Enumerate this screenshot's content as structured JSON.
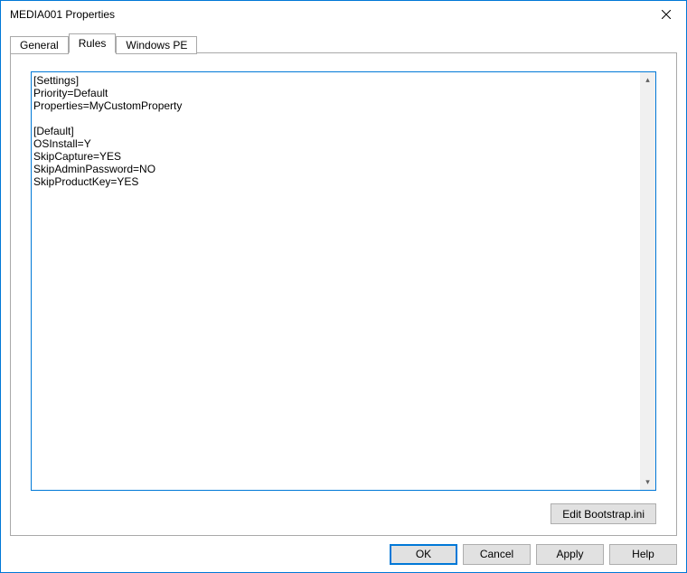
{
  "window": {
    "title": "MEDIA001 Properties"
  },
  "tabs": {
    "general": "General",
    "rules": "Rules",
    "windows_pe": "Windows PE"
  },
  "rules_text": "[Settings]\nPriority=Default\nProperties=MyCustomProperty\n\n[Default]\nOSInstall=Y\nSkipCapture=YES\nSkipAdminPassword=NO\nSkipProductKey=YES",
  "buttons": {
    "edit_bootstrap": "Edit Bootstrap.ini",
    "ok": "OK",
    "cancel": "Cancel",
    "apply": "Apply",
    "help": "Help"
  }
}
